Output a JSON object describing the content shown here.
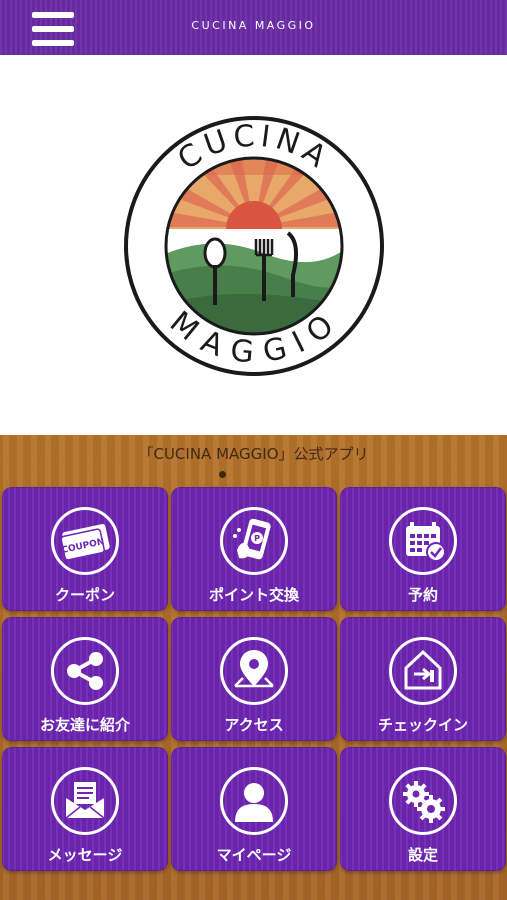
{
  "header": {
    "title": "CUCINA MAGGIO"
  },
  "logo": {
    "top_text": "CUCINA",
    "bottom_text": "MAGGIO"
  },
  "caption": "「CUCINA MAGGIO」公式アプリ",
  "menu": [
    {
      "label": "クーポン",
      "icon": "coupon-icon",
      "badge_text": "COUPON"
    },
    {
      "label": "ポイント交換",
      "icon": "point-exchange-icon"
    },
    {
      "label": "予約",
      "icon": "calendar-icon"
    },
    {
      "label": "お友達に紹介",
      "icon": "share-icon"
    },
    {
      "label": "アクセス",
      "icon": "map-pin-icon"
    },
    {
      "label": "チェックイン",
      "icon": "checkin-icon"
    },
    {
      "label": "メッセージ",
      "icon": "message-icon"
    },
    {
      "label": "マイページ",
      "icon": "user-icon"
    },
    {
      "label": "設定",
      "icon": "gear-icon"
    }
  ],
  "colors": {
    "header": "#6a2ba6",
    "tile": "#7026b5",
    "wood": "#a8682b"
  }
}
